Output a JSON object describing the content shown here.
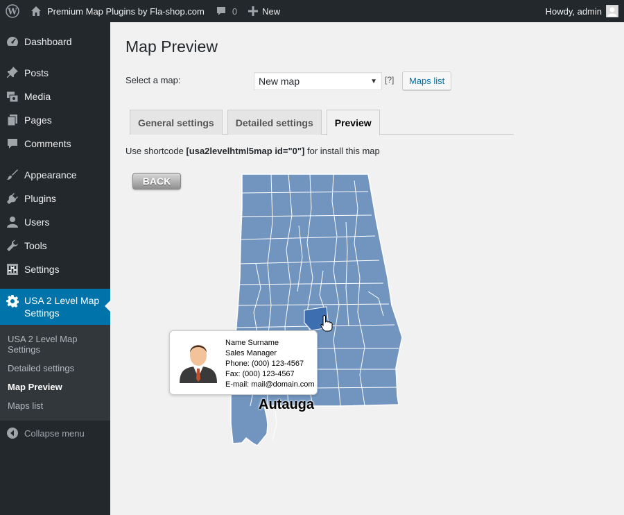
{
  "admin_bar": {
    "site_name": "Premium Map Plugins by Fla-shop.com",
    "comments_count": "0",
    "new_label": "New",
    "howdy": "Howdy, admin"
  },
  "sidebar": {
    "items": [
      {
        "label": "Dashboard",
        "icon": "dashboard-icon"
      },
      {
        "label": "Posts",
        "icon": "pin-icon"
      },
      {
        "label": "Media",
        "icon": "media-icon"
      },
      {
        "label": "Pages",
        "icon": "pages-icon"
      },
      {
        "label": "Comments",
        "icon": "comment-icon"
      },
      {
        "label": "Appearance",
        "icon": "brush-icon"
      },
      {
        "label": "Plugins",
        "icon": "plugin-icon"
      },
      {
        "label": "Users",
        "icon": "user-icon"
      },
      {
        "label": "Tools",
        "icon": "wrench-icon"
      },
      {
        "label": "Settings",
        "icon": "sliders-icon"
      }
    ],
    "current": {
      "label": "USA 2 Level Map Settings",
      "icon": "gear-icon"
    },
    "submenu": [
      {
        "label": "USA 2 Level Map Settings"
      },
      {
        "label": "Detailed settings"
      },
      {
        "label": "Map Preview"
      },
      {
        "label": "Maps list"
      }
    ],
    "collapse_label": "Collapse menu"
  },
  "main": {
    "title": "Map Preview",
    "select_label": "Select a map:",
    "select_value": "New map",
    "help_link": "[?]",
    "maps_list_button": "Maps list",
    "tabs": [
      {
        "label": "General settings"
      },
      {
        "label": "Detailed settings"
      },
      {
        "label": "Preview"
      }
    ],
    "shortcode_prefix": "Use shortcode ",
    "shortcode": "[usa2levelhtml5map id=\"0\"]",
    "shortcode_suffix": " for install this map"
  },
  "map": {
    "back_button": "BACK",
    "tooltip": {
      "name": "Name Surname",
      "title": "Sales Manager",
      "phone": "Phone: (000) 123-4567",
      "fax": "Fax: (000) 123-4567",
      "email": "E-mail: mail@domain.com"
    },
    "hover_label": "Autauga",
    "fill_color": "#7295bf",
    "highlight_color": "#3d6fb0",
    "border_color": "#ffffff"
  }
}
